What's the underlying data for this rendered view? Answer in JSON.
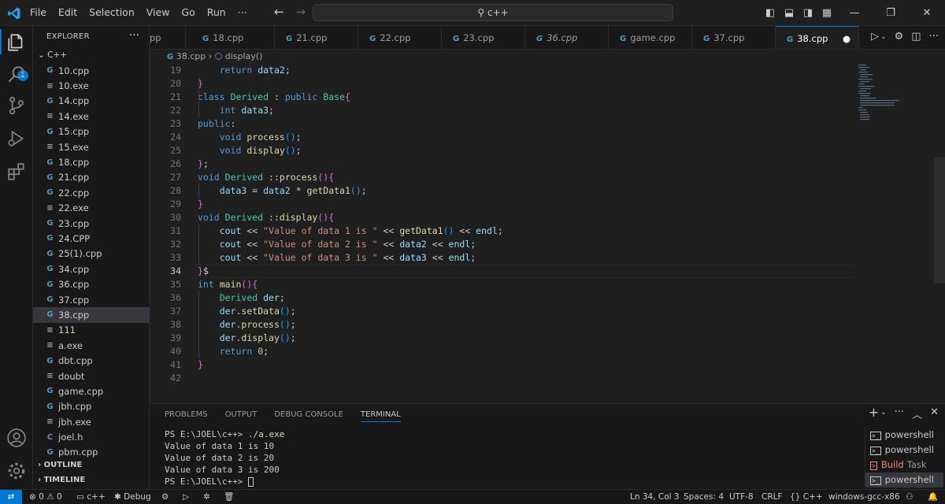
{
  "menu": [
    "File",
    "Edit",
    "Selection",
    "View",
    "Go",
    "Run",
    "···"
  ],
  "search_text": "c++",
  "explorer": {
    "title": "EXPLORER",
    "folder": "C++",
    "files": [
      {
        "name": "10.cpp",
        "type": "cpp"
      },
      {
        "name": "10.exe",
        "type": "exe"
      },
      {
        "name": "14.cpp",
        "type": "cpp"
      },
      {
        "name": "14.exe",
        "type": "exe"
      },
      {
        "name": "15.cpp",
        "type": "cpp"
      },
      {
        "name": "15.exe",
        "type": "exe"
      },
      {
        "name": "18.cpp",
        "type": "cpp"
      },
      {
        "name": "21.cpp",
        "type": "cpp"
      },
      {
        "name": "22.cpp",
        "type": "cpp"
      },
      {
        "name": "22.exe",
        "type": "exe"
      },
      {
        "name": "23.cpp",
        "type": "cpp"
      },
      {
        "name": "24.CPP",
        "type": "cpp"
      },
      {
        "name": "25(1).cpp",
        "type": "cpp"
      },
      {
        "name": "34.cpp",
        "type": "cpp"
      },
      {
        "name": "36.cpp",
        "type": "cpp"
      },
      {
        "name": "37.cpp",
        "type": "cpp"
      },
      {
        "name": "38.cpp",
        "type": "cpp",
        "active": true
      },
      {
        "name": "111",
        "type": "exe"
      },
      {
        "name": "a.exe",
        "type": "exe"
      },
      {
        "name": "dbt.cpp",
        "type": "cpp"
      },
      {
        "name": "doubt",
        "type": "exe"
      },
      {
        "name": "game.cpp",
        "type": "cpp"
      },
      {
        "name": "jbh.cpp",
        "type": "cpp"
      },
      {
        "name": "jbh.exe",
        "type": "exe"
      },
      {
        "name": "joel.h",
        "type": "h"
      },
      {
        "name": "pbm.cpp",
        "type": "cpp"
      }
    ],
    "outline": "OUTLINE",
    "timeline": "TIMELINE"
  },
  "badge": "1",
  "tabs": [
    "pp",
    "18.cpp",
    "21.cpp",
    "22.cpp",
    "23.cpp",
    "36.cpp",
    "game.cpp",
    "37.cpp",
    "38.cpp"
  ],
  "breadcrumb": {
    "file": "38.cpp",
    "symbol": "display()"
  },
  "code_lines": [
    {
      "n": "19",
      "html": "    <span class='k'>return</span> <span class='v'>data2</span>;"
    },
    {
      "n": "20",
      "html": "<span class='br2'>}</span>"
    },
    {
      "n": "21",
      "html": "<span class='k'>class</span> <span class='t'>Derived</span> : <span class='k'>public</span> <span class='t'>Base</span><span class='br2'>{</span>"
    },
    {
      "n": "22",
      "html": "    <span class='k'>int</span> <span class='v'>data3</span>;"
    },
    {
      "n": "23",
      "html": "<span class='k'>public</span>:"
    },
    {
      "n": "24",
      "html": "    <span class='k'>void</span> <span class='f'>process</span><span class='br3'>()</span>;"
    },
    {
      "n": "25",
      "html": "    <span class='k'>void</span> <span class='f'>display</span><span class='br3'>()</span>;"
    },
    {
      "n": "26",
      "html": "<span class='br2'>}</span>;"
    },
    {
      "n": "27",
      "html": "<span class='k'>void</span> <span class='t'>Derived</span> ::<span class='f'>process</span><span class='br2'>()</span><span class='br2'>{</span>"
    },
    {
      "n": "28",
      "html": "    <span class='v'>data3</span> = <span class='v'>data2</span> * <span class='f'>getData1</span><span class='br3'>()</span>;"
    },
    {
      "n": "29",
      "html": "<span class='br2'>}</span>"
    },
    {
      "n": "30",
      "html": "<span class='k'>void</span> <span class='t'>Derived</span> ::<span class='f'>display</span><span class='br2'>()</span><span class='br2'>{</span>"
    },
    {
      "n": "31",
      "html": "    <span class='v'>cout</span> &lt;&lt; <span class='s'>\"Value of data 1 is \"</span> &lt;&lt; <span class='f'>getData1</span><span class='br3'>()</span> &lt;&lt; <span class='v'>endl</span>;"
    },
    {
      "n": "32",
      "html": "    <span class='v'>cout</span> &lt;&lt; <span class='s'>\"Value of data 2 is \"</span> &lt;&lt; <span class='v'>data2</span> &lt;&lt; <span class='v'>endl</span>;"
    },
    {
      "n": "33",
      "html": "    <span class='v'>cout</span> &lt;&lt; <span class='s'>\"Value of data 3 is \"</span> &lt;&lt; <span class='v'>data3</span> &lt;&lt; <span class='v'>endl</span>;"
    },
    {
      "n": "34",
      "html": "<span class='br2'>}</span><span class='p'>$</span>",
      "cur": true
    },
    {
      "n": "35",
      "html": "<span class='k'>int</span> <span class='f'>main</span><span class='br2'>()</span><span class='br2'>{</span>"
    },
    {
      "n": "36",
      "html": "    <span class='t'>Derived</span> <span class='v'>der</span>;"
    },
    {
      "n": "37",
      "html": "    <span class='v'>der</span>.<span class='f'>setData</span><span class='br3'>()</span>;"
    },
    {
      "n": "38",
      "html": "    <span class='v'>der</span>.<span class='f'>process</span><span class='br3'>()</span>;"
    },
    {
      "n": "39",
      "html": "    <span class='v'>der</span>.<span class='f'>display</span><span class='br3'>()</span>;"
    },
    {
      "n": "40",
      "html": "    <span class='k'>return</span> <span class='n'>0</span>;"
    },
    {
      "n": "41",
      "html": "<span class='br2'>}</span>"
    },
    {
      "n": "42",
      "html": ""
    }
  ],
  "panel": {
    "tabs": [
      "PROBLEMS",
      "OUTPUT",
      "DEBUG CONSOLE",
      "TERMINAL"
    ],
    "active": "TERMINAL",
    "terminal_lines": [
      {
        "prompt": "PS E:\\JOEL\\c++> ",
        "cmd": "./a.exe"
      },
      {
        "prompt": "Value of data 1 is 10",
        "cmd": ""
      },
      {
        "prompt": "Value of data 2 is 20",
        "cmd": ""
      },
      {
        "prompt": "Value of data 3 is 200",
        "cmd": ""
      },
      {
        "prompt": "PS E:\\JOEL\\c++> ",
        "cmd": ""
      }
    ],
    "terminals": [
      "powershell",
      "powershell",
      "Build",
      "powershell"
    ],
    "build_suffix": "Task"
  },
  "status": {
    "errors": "0",
    "warnings": "0",
    "folder": "c++",
    "debug": "Debug",
    "position": "Ln 34, Col 3",
    "spaces": "Spaces: 4",
    "encoding": "UTF-8",
    "eol": "CRLF",
    "language": "C++",
    "config": "windows-gcc-x86"
  }
}
